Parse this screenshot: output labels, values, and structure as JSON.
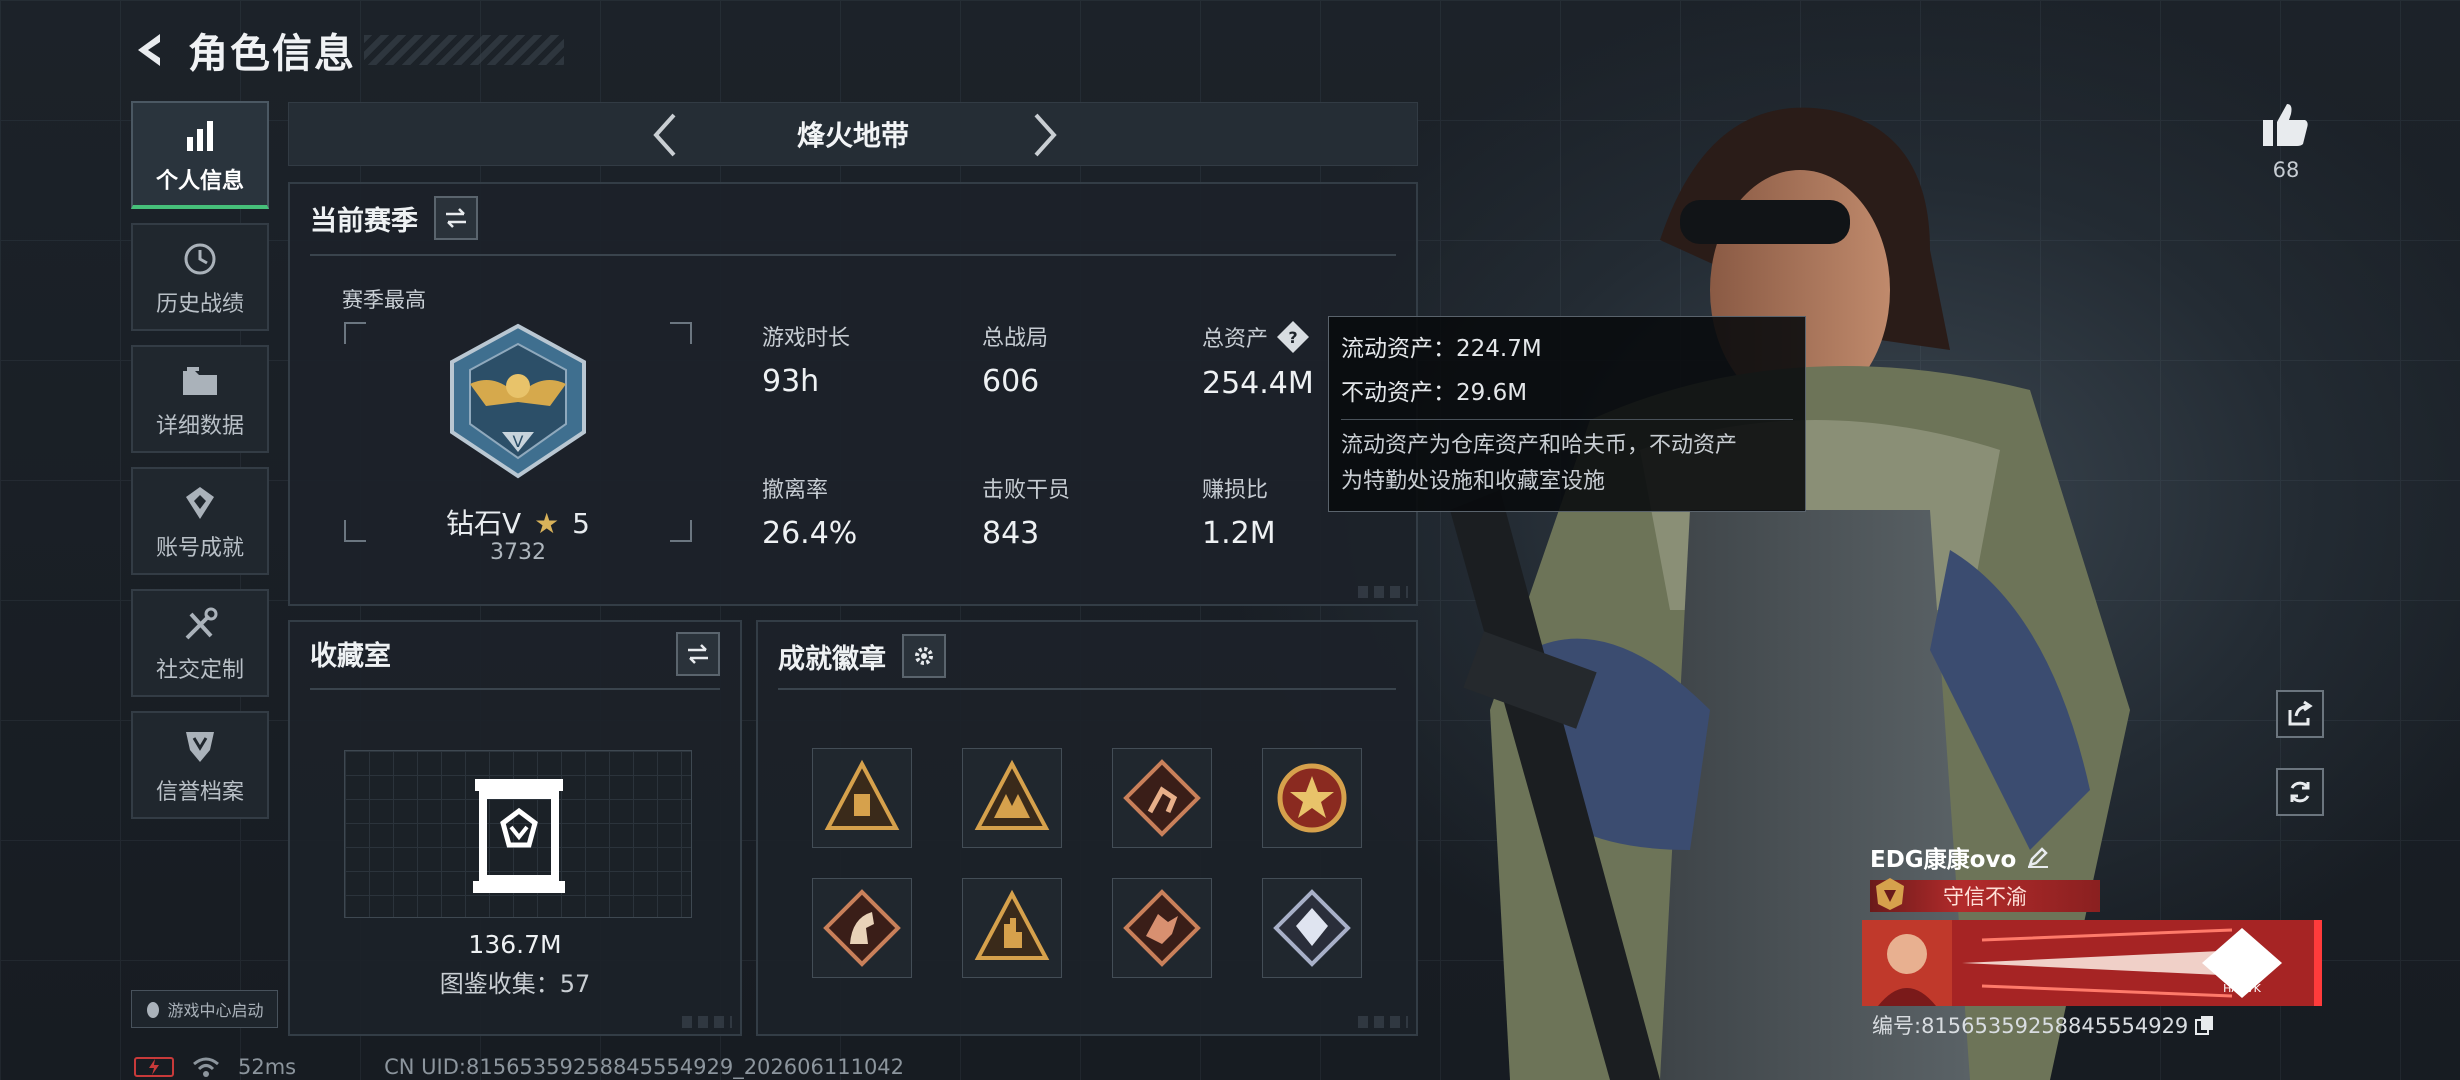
{
  "header": {
    "title": "角色信息"
  },
  "sidebar": {
    "items": [
      {
        "label": "个人信息",
        "icon": "bar-chart-icon",
        "active": true
      },
      {
        "label": "历史战绩",
        "icon": "history-icon"
      },
      {
        "label": "详细数据",
        "icon": "folder-icon"
      },
      {
        "label": "账号成就",
        "icon": "achievement-icon"
      },
      {
        "label": "社交定制",
        "icon": "tools-icon"
      },
      {
        "label": "信誉档案",
        "icon": "shield-icon"
      }
    ],
    "launch_label": "游戏中心启动"
  },
  "mode": {
    "title": "烽火地带"
  },
  "season": {
    "title": "当前赛季",
    "best_label": "赛季最高",
    "rank_name": "钻石V",
    "rank_stars": "5",
    "rank_score": "3732",
    "stats": [
      {
        "label": "游戏时长",
        "value": "93h"
      },
      {
        "label": "总战局",
        "value": "606"
      },
      {
        "label": "总资产",
        "value": "254.4M"
      },
      {
        "label": "撤离率",
        "value": "26.4%"
      },
      {
        "label": "击败干员",
        "value": "843"
      },
      {
        "label": "赚损比",
        "value": "1.2M"
      }
    ]
  },
  "tooltip": {
    "liquid": "流动资产：224.7M",
    "fixed": "不动资产：29.6M",
    "desc_line1": "流动资产为仓库资产和哈夫币，不动资产",
    "desc_line2": "为特勤处设施和收藏室设施"
  },
  "collection": {
    "title": "收藏室",
    "value": "136.7M",
    "count": "图鉴收集：57"
  },
  "badges": {
    "title": "成就徽章",
    "items": [
      "badge-1",
      "badge-2",
      "badge-3",
      "badge-4",
      "badge-5",
      "badge-6",
      "badge-7",
      "badge-8"
    ]
  },
  "profile": {
    "likes": "68",
    "name": "EDG康康ovo",
    "title_tag": "守信不渝",
    "uid_card": "编号:81565359258845554929",
    "banner_brand": "HAAVK"
  },
  "footer": {
    "ping": "52ms",
    "uid": "CN UID:81565359258845554929_202606111042"
  },
  "colors": {
    "accent_green": "#46c07a",
    "title_red": "#b32b2b",
    "panel_bg": "#1c2229"
  }
}
